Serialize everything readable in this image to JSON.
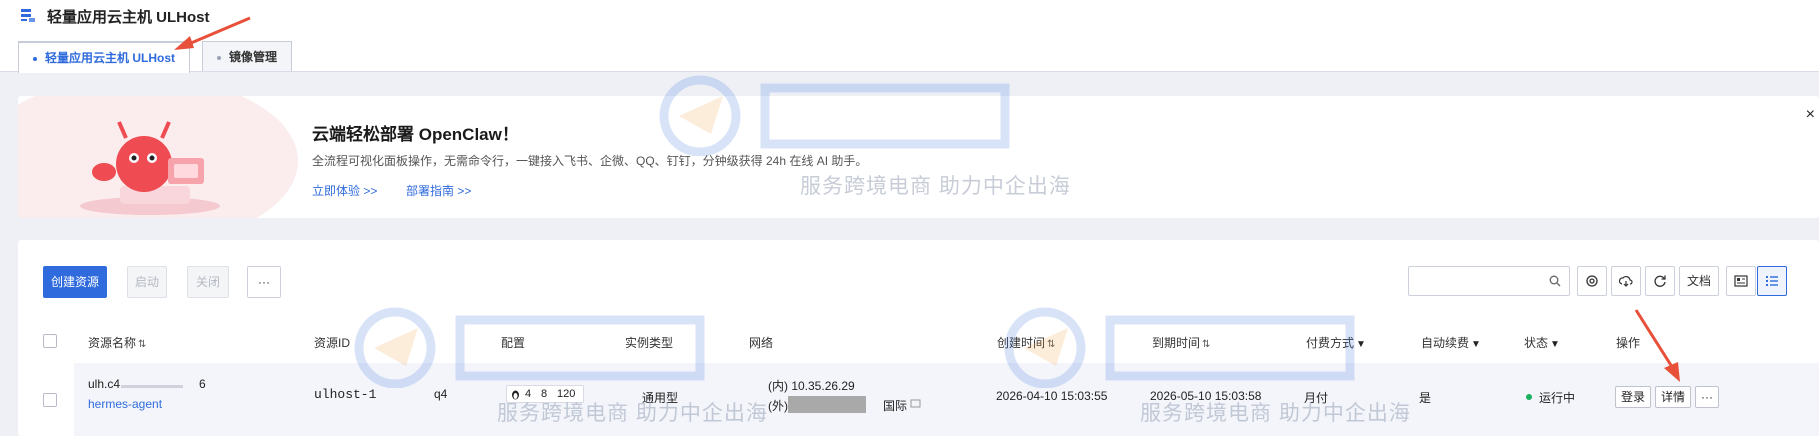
{
  "app": {
    "title": "轻量应用云主机 ULHost"
  },
  "tabs": [
    {
      "label": "轻量应用云主机 ULHost",
      "active": true
    },
    {
      "label": "镜像管理",
      "active": false
    }
  ],
  "banner": {
    "title": "云端轻松部署 OpenClaw！",
    "description": "全流程可视化面板操作，无需命令行，一键接入飞书、企微、QQ、钉钉，分钟级获得 24h 在线 AI 助手。",
    "link_try": "立即体验 >>",
    "link_guide": "部署指南 >>",
    "close": "×"
  },
  "toolbar": {
    "create": "创建资源",
    "start": "启动",
    "stop": "关闭",
    "more": "···",
    "search_placeholder": "",
    "docs": "文档"
  },
  "table": {
    "headers": {
      "name": "资源名称",
      "id": "资源ID",
      "config": "配置",
      "instance_type": "实例类型",
      "network": "网络",
      "created": "创建时间",
      "expires": "到期时间",
      "billing": "付费方式",
      "auto_renew": "自动续费",
      "status": "状态",
      "actions": "操作"
    },
    "rows": [
      {
        "name_prefix": "ulh.c4",
        "name_suffix": "6",
        "subtitle": "hermes-agent",
        "id_prefix": "ulhost-1",
        "id_suffix": "q4",
        "config": [
          "4",
          "8",
          "120"
        ],
        "instance_type": "通用型",
        "ip_internal": "(内) 10.35.26.29",
        "ip_external_label": "(外)",
        "ip_region": "国际",
        "created": "2026-04-10 15:03:55",
        "expires": "2026-05-10 15:03:58",
        "billing": "月付",
        "auto_renew": "是",
        "status": "运行中",
        "btn_login": "登录",
        "btn_detail": "详情",
        "btn_more": "···"
      }
    ]
  },
  "watermark": {
    "slogan": "服务跨境电商 助力中企出海"
  },
  "colors": {
    "accent": "#2f6bdc",
    "running": "#1ab05e",
    "annotation": "#e8503a"
  }
}
